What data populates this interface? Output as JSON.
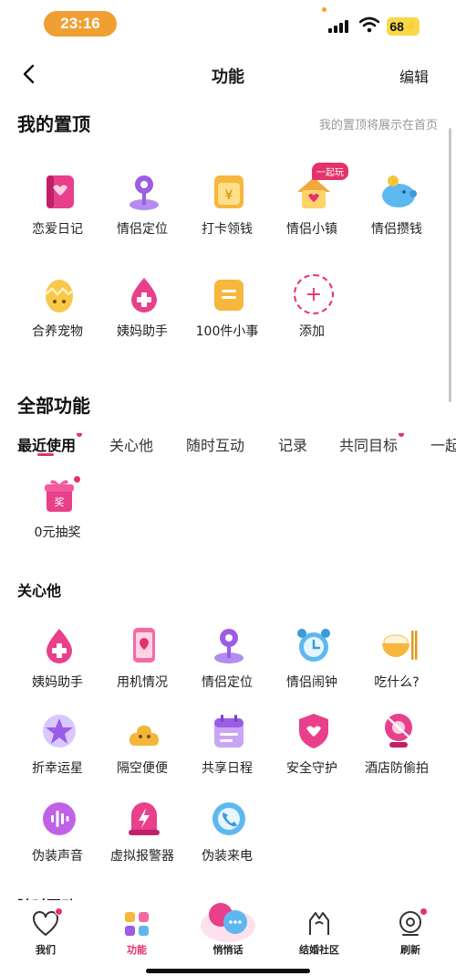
{
  "status_bar": {
    "time": "23:16",
    "battery": "68"
  },
  "header": {
    "title": "功能",
    "edit_label": "编辑"
  },
  "pinned": {
    "title": "我的置顶",
    "hint": "我的置顶将展示在首页",
    "items": [
      {
        "label": "恋爱日记",
        "icon": "love-diary-icon"
      },
      {
        "label": "情侣定位",
        "icon": "location-pin-icon"
      },
      {
        "label": "打卡领钱",
        "icon": "checkin-money-icon"
      },
      {
        "label": "情侣小镇",
        "icon": "couple-town-icon",
        "tag": "一起玩"
      },
      {
        "label": "情侣攒钱",
        "icon": "piggy-bank-icon"
      },
      {
        "label": "合养宠物",
        "icon": "pet-egg-icon"
      },
      {
        "label": "姨妈助手",
        "icon": "period-helper-icon"
      },
      {
        "label": "100件小事",
        "icon": "checklist-icon"
      },
      {
        "label": "添加",
        "icon": "add-icon"
      }
    ]
  },
  "all": {
    "title": "全部功能",
    "tabs": [
      "最近使用",
      "关心他",
      "随时互动",
      "记录",
      "共同目标",
      "一起"
    ],
    "recent": [
      {
        "label": "0元抽奖",
        "icon": "gift-box-icon"
      }
    ]
  },
  "care": {
    "title": "关心他",
    "items": [
      {
        "label": "姨妈助手",
        "icon": "period-helper-icon"
      },
      {
        "label": "用机情况",
        "icon": "phone-usage-icon"
      },
      {
        "label": "情侣定位",
        "icon": "location-pin-icon"
      },
      {
        "label": "情侣闹钟",
        "icon": "alarm-clock-icon"
      },
      {
        "label": "吃什么?",
        "icon": "rice-bowl-icon"
      },
      {
        "label": "折幸运星",
        "icon": "lucky-star-icon"
      },
      {
        "label": "隔空便便",
        "icon": "poop-icon"
      },
      {
        "label": "共享日程",
        "icon": "calendar-icon"
      },
      {
        "label": "安全守护",
        "icon": "shield-heart-icon"
      },
      {
        "label": "酒店防偷拍",
        "icon": "camera-block-icon"
      },
      {
        "label": "伪装声音",
        "icon": "voice-wave-icon"
      },
      {
        "label": "虚拟报警器",
        "icon": "alarm-siren-icon"
      },
      {
        "label": "伪装来电",
        "icon": "phone-call-icon"
      }
    ]
  },
  "peek_section": "随时互动",
  "bottom_nav": [
    {
      "label": "我们",
      "icon": "heart-outline-icon"
    },
    {
      "label": "功能",
      "icon": "apps-grid-icon"
    },
    {
      "label": "悄悄话",
      "icon": "chat-bubbles-icon"
    },
    {
      "label": "结婚社区",
      "icon": "couple-hands-icon"
    },
    {
      "label": "刷新",
      "icon": "refresh-icon"
    }
  ],
  "colors": {
    "accent": "#e4326a",
    "time_pill": "#f0a033",
    "battery": "#f7d84a"
  }
}
